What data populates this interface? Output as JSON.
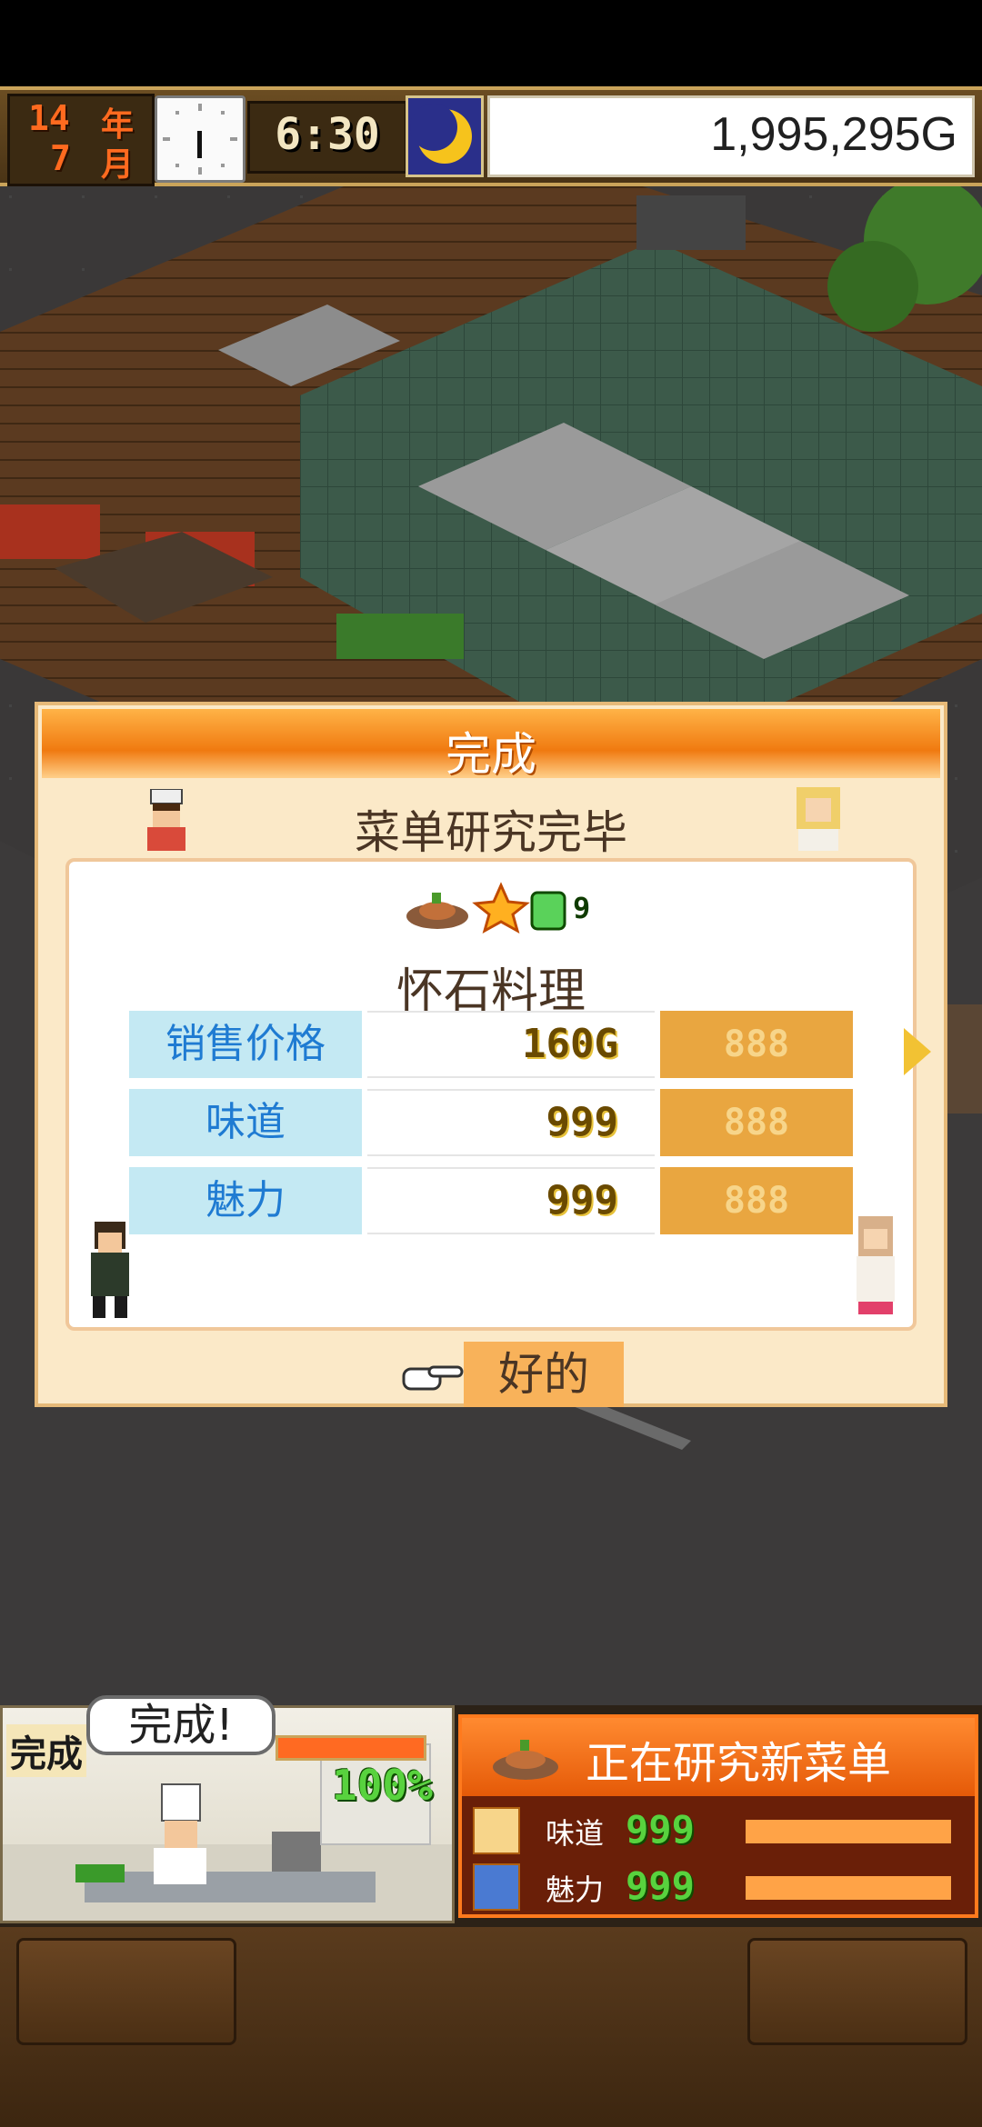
{
  "topbar": {
    "year_num": "14",
    "year_unit": "年",
    "month_num": "7",
    "month_unit": "月",
    "time": "6:30",
    "money": "1,995,295G"
  },
  "dialog": {
    "title": "完成",
    "subtitle": "菜单研究完毕",
    "rank": "9",
    "dish_name": "怀石料理",
    "stats": [
      {
        "label": "销售价格",
        "value": "160G",
        "bar": "888"
      },
      {
        "label": "味道",
        "value": "999",
        "bar": "888"
      },
      {
        "label": "魅力",
        "value": "999",
        "bar": "888"
      }
    ],
    "ok_label": "好的"
  },
  "bottom": {
    "kitchen_label": "完成",
    "bubble": "完成!",
    "progress": "100%",
    "research_title": "正在研究新菜单",
    "rows": [
      {
        "label": "味道",
        "value": "999"
      },
      {
        "label": "魅力",
        "value": "999"
      }
    ]
  },
  "colors": {
    "accent_orange": "#f07a10",
    "dialog_bg": "#fbe9c8",
    "stat_label_bg": "#c4e9f3",
    "stat_label_text": "#1f7bd2",
    "progress_green": "#58d23e"
  }
}
